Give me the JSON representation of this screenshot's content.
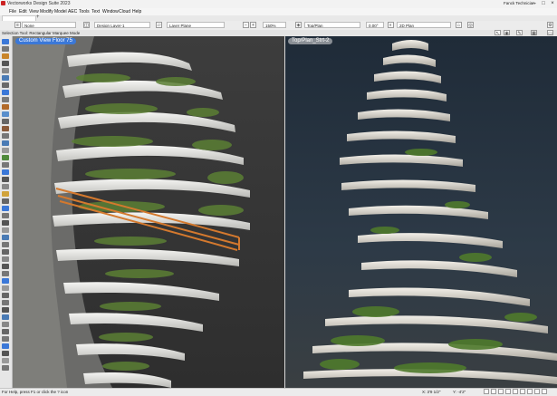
{
  "window": {
    "title": "Vectorworks Design Suite 2023",
    "user": "Fanck Technician"
  },
  "menu": [
    "File",
    "Edit",
    "View",
    "Modify",
    "Model",
    "AEC",
    "Tools",
    "Text",
    "Window",
    "Cloud",
    "Help"
  ],
  "toolbar": {
    "class_field": "None",
    "layer_field": "Design Layer-1",
    "layer_plane_field": "Layer Plane",
    "zoom_field": "150%",
    "view_field": "Top/Plan",
    "angle_field": "0.00°",
    "render_field": "2D Plan"
  },
  "mode_bar": {
    "text": "Selection Tool: Rectangular Marquee Mode"
  },
  "viewports": {
    "left": {
      "label": "Custom View Floor 75"
    },
    "right": {
      "label": "Top/Plan_Strt-2"
    }
  },
  "status": {
    "hint": "For Help, press F1 or click the ? icon",
    "x": "X: 3'9 1/2\"",
    "y": "Y: -4'2\""
  },
  "colors": {
    "accent": "#3b78d8",
    "highlight": "#d4792e"
  }
}
